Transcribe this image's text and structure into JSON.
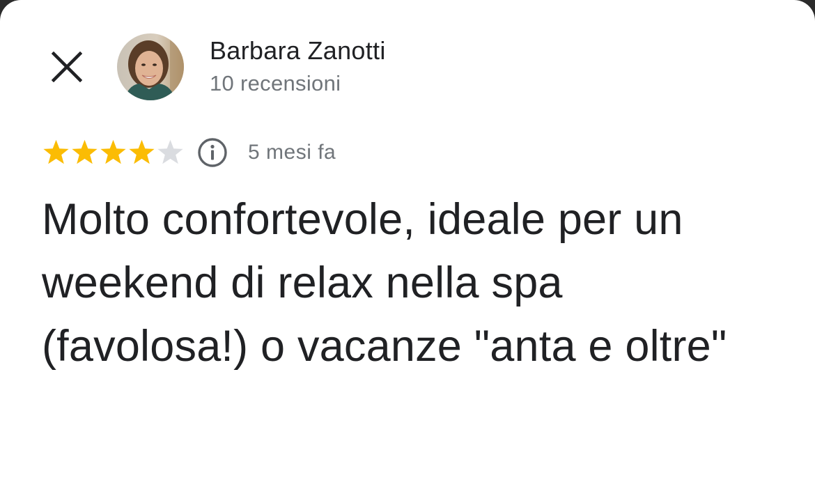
{
  "review": {
    "author_name": "Barbara Zanotti",
    "author_reviews_count": "10 recensioni",
    "rating": 4,
    "rating_max": 5,
    "time_ago": "5 mesi fa",
    "text": "Molto confortevole, ideale per un weekend di relax nella spa (favolosa!) o vacanze \"anta e oltre\""
  },
  "icons": {
    "close": "close-icon",
    "info": "info-icon",
    "star_filled": "star-filled-icon",
    "star_empty": "star-empty-icon"
  },
  "colors": {
    "star_filled": "#fbbc04",
    "star_empty": "#dadce0",
    "text_primary": "#202124",
    "text_secondary": "#70757a"
  }
}
